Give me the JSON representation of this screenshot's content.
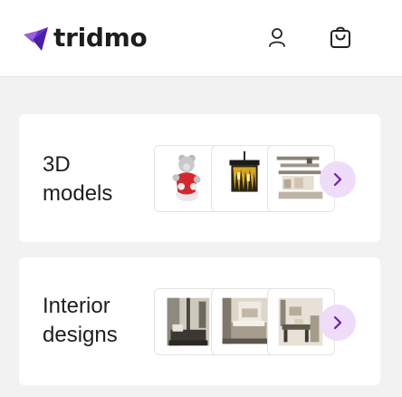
{
  "brand": {
    "name": "tridmo",
    "accent_color": "#7b2fd9",
    "dark_accent": "#4a1fa8"
  },
  "header": {
    "user_icon": "user-icon",
    "cart_icon": "shopping-bag-icon"
  },
  "sections": [
    {
      "title_line1": "3D",
      "title_line2": "models",
      "thumbnails": [
        "teddy-bear-model",
        "gold-chandelier-model",
        "kitchen-shelf-model"
      ],
      "next_icon": "chevron-right-icon"
    },
    {
      "title_line1": "Interior",
      "title_line2": "designs",
      "thumbnails": [
        "bathroom-interior",
        "bedroom-interior",
        "dining-room-interior"
      ],
      "next_icon": "chevron-right-icon"
    }
  ]
}
